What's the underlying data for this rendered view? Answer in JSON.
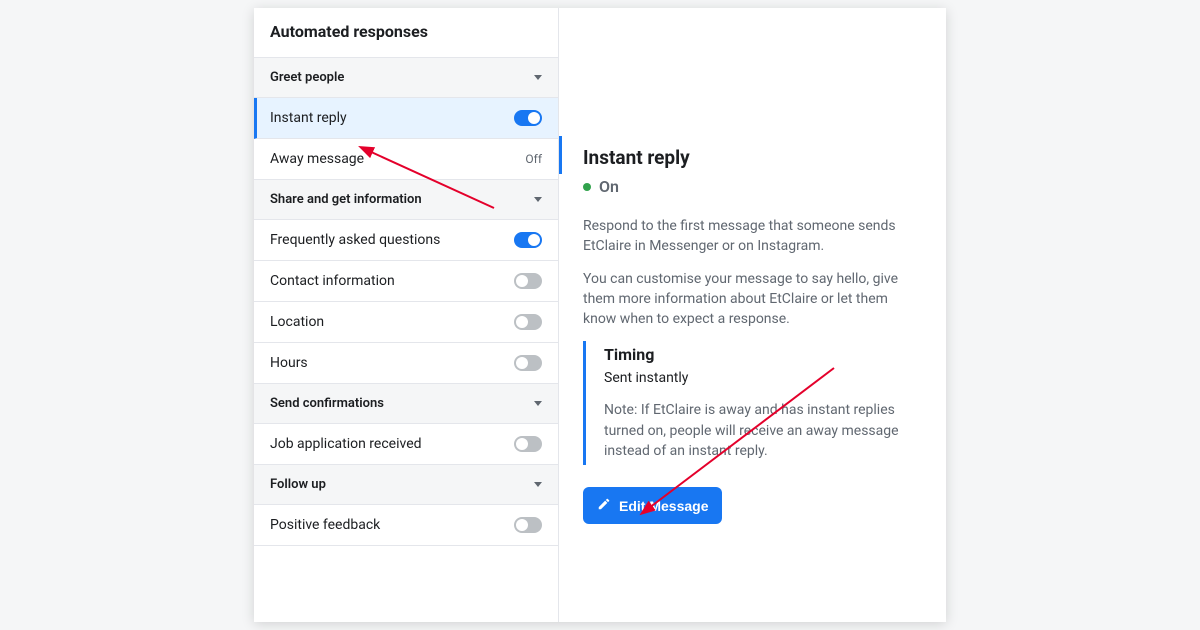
{
  "left": {
    "title": "Automated responses",
    "sections": [
      {
        "label": "Greet people",
        "items": [
          {
            "name": "instant-reply",
            "label": "Instant reply",
            "state": "toggle-on",
            "selected": true
          },
          {
            "name": "away-message",
            "label": "Away message",
            "state": "off-text",
            "off_text": "Off"
          }
        ]
      },
      {
        "label": "Share and get information",
        "items": [
          {
            "name": "faq",
            "label": "Frequently asked questions",
            "state": "toggle-on"
          },
          {
            "name": "contact-info",
            "label": "Contact information",
            "state": "toggle-off"
          },
          {
            "name": "location",
            "label": "Location",
            "state": "toggle-off"
          },
          {
            "name": "hours",
            "label": "Hours",
            "state": "toggle-off"
          }
        ]
      },
      {
        "label": "Send confirmations",
        "items": [
          {
            "name": "job-app-received",
            "label": "Job application received",
            "state": "toggle-off"
          }
        ]
      },
      {
        "label": "Follow up",
        "items": [
          {
            "name": "positive-feedback",
            "label": "Positive feedback",
            "state": "toggle-off"
          }
        ]
      }
    ]
  },
  "right": {
    "title": "Instant reply",
    "state_label": "On",
    "desc1": "Respond to the first message that someone sends EtClaire in Messenger or on Instagram.",
    "desc2": "You can customise your message to say hello, give them more information about EtClaire or let them know when to expect a response.",
    "timing": {
      "title": "Timing",
      "sub": "Sent instantly",
      "note": "Note: If EtClaire is away and has instant replies turned on, people will receive an away message instead of an instant reply."
    },
    "edit_button_label": "Edit Message"
  }
}
